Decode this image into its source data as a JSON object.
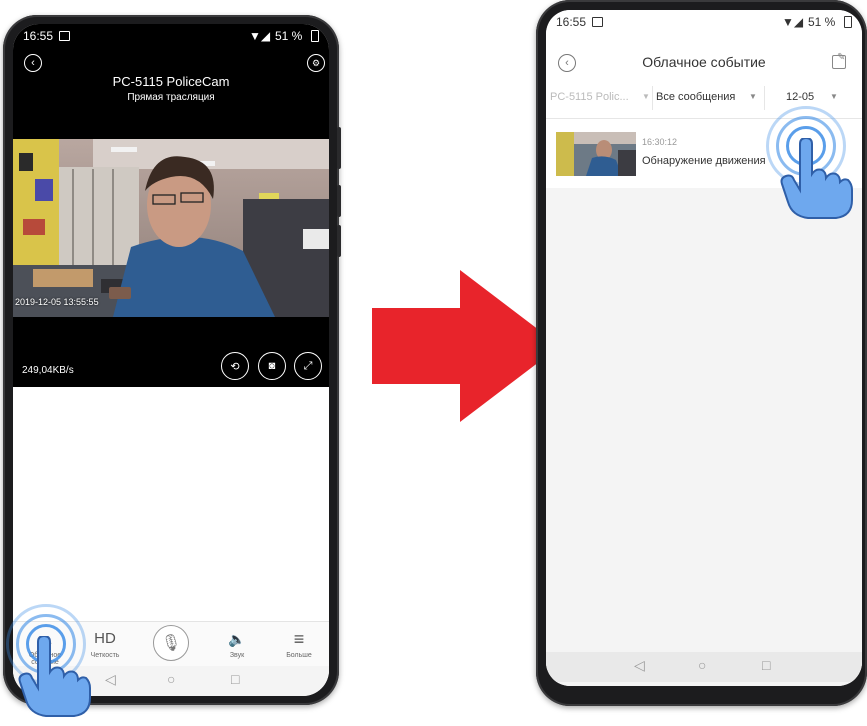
{
  "left_phone": {
    "status": {
      "time": "16:55",
      "battery": "51 %"
    },
    "header": {
      "title": "PC-5115 PoliceCam",
      "subtitle": "Прямая трасляция"
    },
    "video": {
      "timestamp": "2019-12-05 13:55:55"
    },
    "bitrate": "249,04KB/s",
    "toolbar": {
      "cloud_label_1": "Облачное",
      "cloud_label_2": "событие",
      "hd_icon": "HD",
      "hd_label": "Четкость",
      "sound_label": "Звук",
      "more_label": "Больше"
    },
    "nav": {
      "back": "◁",
      "home": "○",
      "recent": "□"
    }
  },
  "right_phone": {
    "status": {
      "time": "16:55",
      "battery": "51 %"
    },
    "header": {
      "title": "Облачное событие"
    },
    "filters": {
      "device": "PC-5115 Polic...",
      "messages": "Все сообщения",
      "date": "12-05"
    },
    "event": {
      "time": "16:30:12",
      "title": "Обнаружение движения"
    },
    "nav": {
      "back": "◁",
      "home": "○",
      "recent": "□"
    }
  },
  "colors": {
    "arrow": "#e8242b",
    "tap_ring": "#3d8de6",
    "hand": "#6ea8ee"
  },
  "icons": {
    "back": "chevron-left-icon",
    "settings": "gear-icon",
    "playback": "playback-icon",
    "snapshot": "camera-icon",
    "fullscreen": "fullscreen-icon",
    "cloud": "cloud-icon",
    "mic": "microphone-icon",
    "sound": "speaker-icon",
    "more": "menu-icon",
    "edit": "edit-icon"
  }
}
